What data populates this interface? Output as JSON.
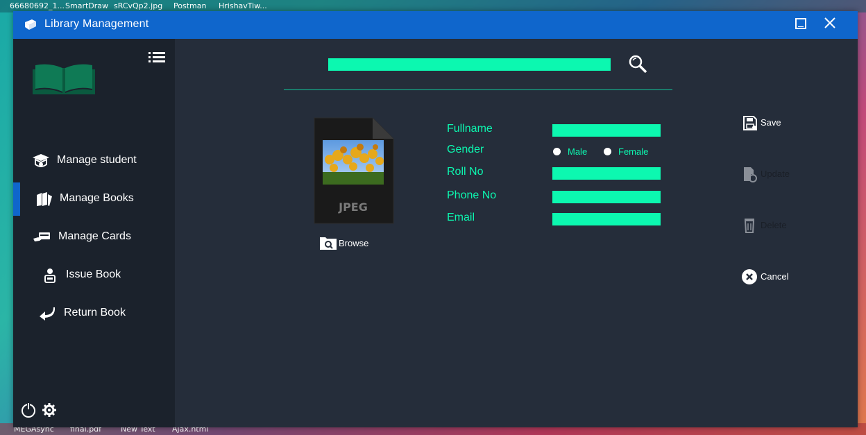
{
  "desktop": {
    "top_items": [
      "66680692_1...",
      "SmartDraw",
      "sRCvQp2.jpg",
      "Postman",
      "HrishavTiw..."
    ],
    "bottom_items": [
      "MEGAsync",
      "final.pdf",
      "New Text",
      "Ajax.html"
    ]
  },
  "window": {
    "title": "Library Management"
  },
  "sidebar": {
    "items": [
      {
        "label": "Manage student",
        "icon": "graduation-cap-icon",
        "active": false
      },
      {
        "label": "Manage Books",
        "icon": "books-icon",
        "active": true
      },
      {
        "label": "Manage Cards",
        "icon": "card-hand-icon",
        "active": false
      },
      {
        "label": "Issue Book",
        "icon": "person-book-icon",
        "active": false
      },
      {
        "label": "Return Book",
        "icon": "return-arrow-icon",
        "active": false
      }
    ]
  },
  "search": {
    "value": ""
  },
  "photo": {
    "format_label": "JPEG",
    "browse_label": "Browse"
  },
  "form": {
    "fullname_label": "Fullname",
    "gender_label": "Gender",
    "gender_male": "Male",
    "gender_female": "Female",
    "rollno_label": "Roll No",
    "phone_label": "Phone No",
    "email_label": "Email",
    "fullname_value": "",
    "rollno_value": "",
    "phone_value": "",
    "email_value": ""
  },
  "actions": {
    "save": "Save",
    "update": "Update",
    "delete": "Delete",
    "cancel": "Cancel"
  },
  "colors": {
    "accent": "#0cf8b0",
    "titlebar": "#0f66cc",
    "sidebar": "#1b222c",
    "content": "#252d3a"
  }
}
